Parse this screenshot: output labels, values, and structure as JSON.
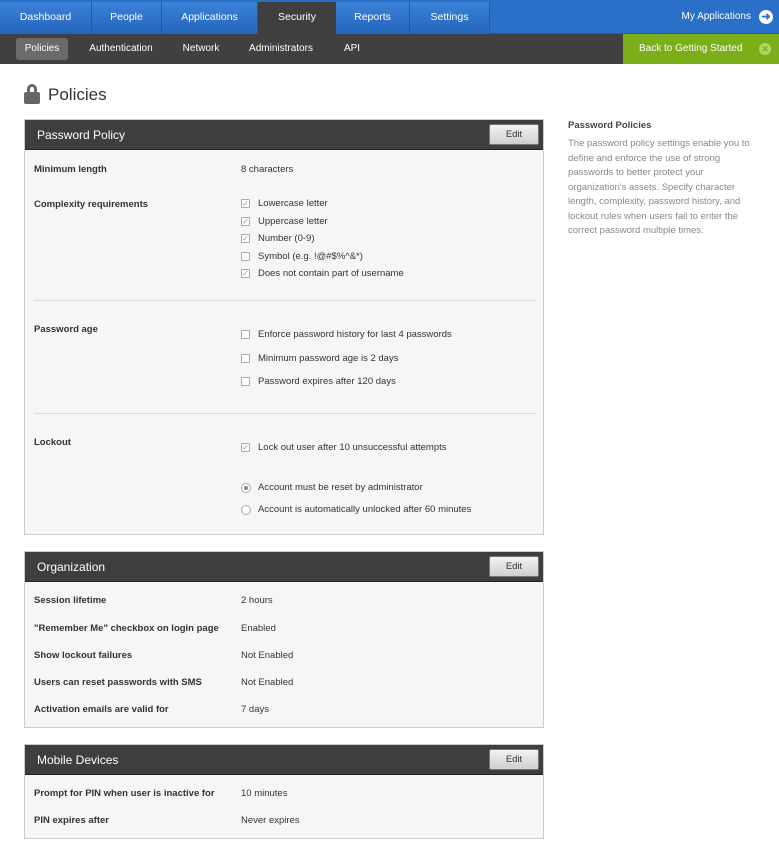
{
  "topnav": {
    "tabs": [
      "Dashboard",
      "People",
      "Applications",
      "Security",
      "Reports",
      "Settings"
    ],
    "my_applications": "My Applications"
  },
  "subnav": {
    "items": [
      "Policies",
      "Authentication",
      "Network",
      "Administrators",
      "API"
    ],
    "back_to_getting_started": "Back to Getting Started"
  },
  "page": {
    "title": "Policies"
  },
  "password_policy": {
    "title": "Password Policy",
    "edit": "Edit",
    "min_length_label": "Minimum length",
    "min_length_value": "8 characters",
    "complexity_label": "Complexity requirements",
    "complexity_options": [
      {
        "label": "Lowercase letter",
        "checked": true
      },
      {
        "label": "Uppercase letter",
        "checked": true
      },
      {
        "label": "Number (0-9)",
        "checked": true
      },
      {
        "label": "Symbol (e.g. !@#$%^&*)",
        "checked": false
      },
      {
        "label": "Does not contain part of username",
        "checked": true
      }
    ],
    "age_label": "Password age",
    "age_options": [
      {
        "label": "Enforce password history for last 4 passwords",
        "checked": false
      },
      {
        "label": "Minimum password age is 2 days",
        "checked": false
      },
      {
        "label": "Password expires after 120 days",
        "checked": false
      }
    ],
    "lockout_label": "Lockout",
    "lockout_option": {
      "label": "Lock out user after 10 unsuccessful attempts",
      "checked": true
    },
    "lockout_radios": [
      {
        "label": "Account must be reset by administrator",
        "selected": true
      },
      {
        "label": "Account is automatically unlocked after 60 minutes",
        "selected": false
      }
    ]
  },
  "organization": {
    "title": "Organization",
    "edit": "Edit",
    "rows": [
      {
        "label": "Session lifetime",
        "value": "2 hours"
      },
      {
        "label": "\"Remember Me\" checkbox on login page",
        "value": "Enabled"
      },
      {
        "label": "Show lockout failures",
        "value": "Not Enabled"
      },
      {
        "label": "Users can reset passwords with SMS",
        "value": "Not Enabled"
      },
      {
        "label": "Activation emails are valid for",
        "value": "7 days"
      }
    ]
  },
  "mobile": {
    "title": "Mobile Devices",
    "edit": "Edit",
    "rows": [
      {
        "label": "Prompt for PIN when user is inactive for",
        "value": "10 minutes"
      },
      {
        "label": "PIN expires after",
        "value": "Never expires"
      }
    ]
  },
  "help": {
    "title": "Password Policies",
    "text": "The password policy settings enable you to define and enforce the use of strong passwords to better protect your organization's assets. Specify character length, complexity, password history, and lockout rules when users fail to enter the correct password multiple times."
  },
  "colors": {
    "nav_blue": "#2a70c8",
    "nav_dark": "#3f3f3f",
    "getting_started_green": "#7cae1a"
  }
}
